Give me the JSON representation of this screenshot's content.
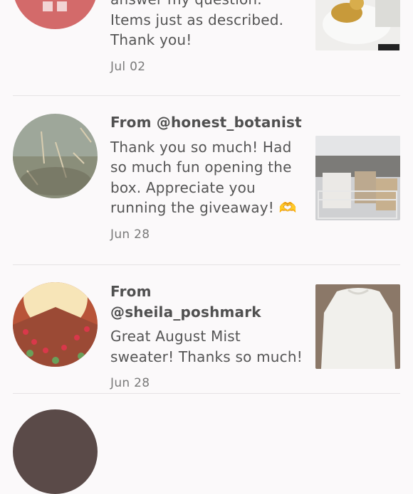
{
  "reviews": [
    {
      "from": "",
      "message_lines": [
        "answer my question.",
        "Items just as described.",
        "Thank you!"
      ],
      "date": "Jul 02"
    },
    {
      "from": "From @honest_botanist",
      "message_lines": [
        "Thank you so much! Had",
        "so much fun opening the",
        "box. Appreciate you",
        "running the giveaway! 🫶"
      ],
      "date": "Jun 28"
    },
    {
      "from": "From @sheila_poshmark",
      "message_lines": [
        "Great August Mist",
        "sweater! Thanks so much!"
      ],
      "date": "Jun 28"
    }
  ],
  "colors": {
    "background": "#fbf9fa",
    "divider": "#e6e3e5",
    "text": "#555555",
    "date_text": "#7a7a7a",
    "avatar_red": "#d36a6a"
  }
}
